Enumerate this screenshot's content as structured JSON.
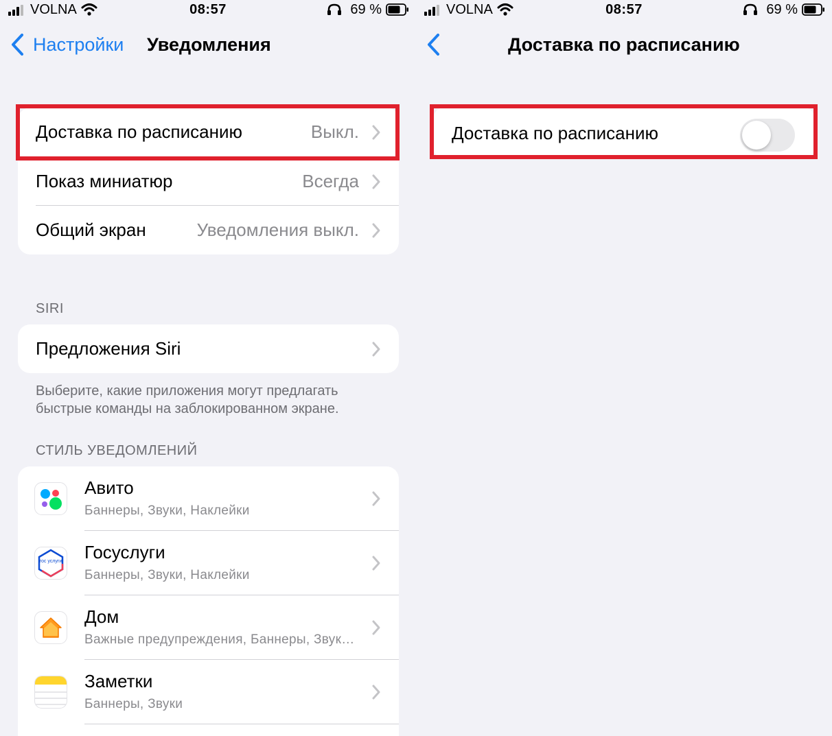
{
  "status_bar": {
    "carrier": "VOLNA",
    "time": "08:57",
    "battery": "69 %"
  },
  "left_screen": {
    "nav": {
      "back_label": "Настройки",
      "title": "Уведомления"
    },
    "top_group": [
      {
        "label": "Доставка по расписанию",
        "value": "Выкл."
      },
      {
        "label": "Показ миниатюр",
        "value": "Всегда"
      },
      {
        "label": "Общий экран",
        "value": "Уведомления выкл."
      }
    ],
    "siri_section": {
      "header": "SIRI",
      "row_label": "Предложения Siri",
      "footer": "Выберите, какие приложения могут предлагать быстрые команды на заблокированном экране."
    },
    "style_section": {
      "header": "СТИЛЬ УВЕДОМЛЕНИЙ",
      "apps": [
        {
          "name": "Авито",
          "detail": "Баннеры, Звуки, Наклейки",
          "icon": "avito-icon"
        },
        {
          "name": "Госуслуги",
          "detail": "Баннеры, Звуки, Наклейки",
          "icon": "gosuslugi-icon",
          "icon_text": "гос услуги"
        },
        {
          "name": "Дом",
          "detail": "Важные предупреждения, Баннеры, Звуки, Наклейки",
          "icon": "home-icon"
        },
        {
          "name": "Заметки",
          "detail": "Баннеры, Звуки",
          "icon": "notes-icon"
        }
      ]
    }
  },
  "right_screen": {
    "nav": {
      "title": "Доставка по расписанию"
    },
    "toggle_row": {
      "label": "Доставка по расписанию",
      "enabled": false
    }
  },
  "colors": {
    "background": "#f2f2f7",
    "accent": "#1d7ff0",
    "highlight": "#e0212d",
    "secondary_text": "#8a8a8e"
  }
}
